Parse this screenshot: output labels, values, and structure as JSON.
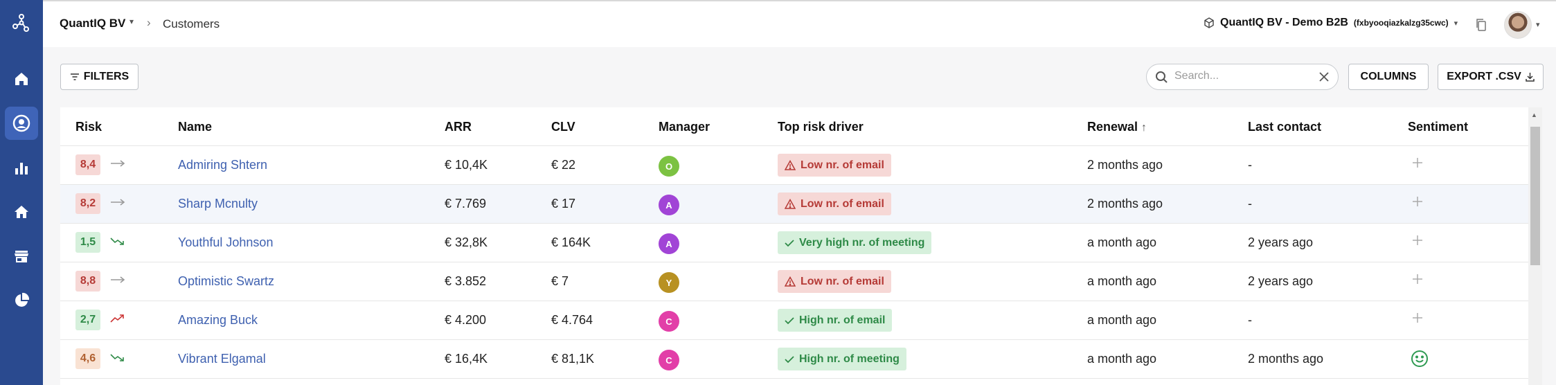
{
  "colors": {
    "sidebar": "#2a4a8f",
    "sidebar_active": "#3f64b8",
    "link": "#3f61b0",
    "risk_high_bg": "#f6d8d6",
    "risk_high_fg": "#b53a36",
    "risk_low_bg": "#d6f0dc",
    "risk_low_fg": "#2e8a47",
    "risk_mid_bg": "#f9e2d3",
    "risk_mid_fg": "#b0602f"
  },
  "sidebar": {
    "logo_icon": "network-logo-icon",
    "items": [
      {
        "icon": "home-icon"
      },
      {
        "icon": "user-circle-icon",
        "active": true
      },
      {
        "icon": "bar-chart-icon"
      },
      {
        "icon": "house-icon"
      },
      {
        "icon": "store-icon"
      },
      {
        "icon": "pie-chart-icon"
      }
    ]
  },
  "header": {
    "org": "QuantIQ BV",
    "separator": "›",
    "page": "Customers",
    "tenant_name": "QuantIQ BV - Demo B2B",
    "tenant_id": "(fxbyooqiazkalzg35cwc)"
  },
  "toolbar": {
    "filters_label": "FILTERS",
    "search_placeholder": "Search...",
    "columns_label": "COLUMNS",
    "export_label": "EXPORT .CSV"
  },
  "table": {
    "columns": [
      "Risk",
      "Name",
      "ARR",
      "CLV",
      "Manager",
      "Top risk driver",
      "Renewal",
      "Last contact",
      "Sentiment"
    ],
    "renewal_sort_arrow": "↑",
    "rows": [
      {
        "risk": "8,4",
        "level": "high",
        "trend": "flat",
        "name": "Admiring Shtern",
        "arr": "€ 10,4K",
        "clv": "€ 22",
        "manager": "O",
        "manager_color": "#7cc242",
        "driver": "Low nr. of email",
        "driver_kind": "warn",
        "renewal": "2 months ago",
        "last_contact": "-",
        "sentiment": "plus"
      },
      {
        "risk": "8,2",
        "level": "high",
        "trend": "flat",
        "name": "Sharp Mcnulty",
        "arr": "€ 7.769",
        "clv": "€ 17",
        "manager": "A",
        "manager_color": "#a144d6",
        "driver": "Low nr. of email",
        "driver_kind": "warn",
        "renewal": "2 months ago",
        "last_contact": "-",
        "sentiment": "plus",
        "highlight": true
      },
      {
        "risk": "1,5",
        "level": "low",
        "trend": "down",
        "name": "Youthful Johnson",
        "arr": "€ 32,8K",
        "clv": "€ 164K",
        "manager": "A",
        "manager_color": "#a144d6",
        "driver": "Very high nr. of meeting",
        "driver_kind": "ok",
        "renewal": "a month ago",
        "last_contact": "2 years ago",
        "sentiment": "plus"
      },
      {
        "risk": "8,8",
        "level": "high",
        "trend": "flat",
        "name": "Optimistic Swartz",
        "arr": "€ 3.852",
        "clv": "€ 7",
        "manager": "Y",
        "manager_color": "#b89122",
        "driver": "Low nr. of email",
        "driver_kind": "warn",
        "renewal": "a month ago",
        "last_contact": "2 years ago",
        "sentiment": "plus"
      },
      {
        "risk": "2,7",
        "level": "low",
        "trend": "up",
        "name": "Amazing Buck",
        "arr": "€ 4.200",
        "clv": "€ 4.764",
        "manager": "C",
        "manager_color": "#e23fa8",
        "driver": "High nr. of email",
        "driver_kind": "ok",
        "renewal": "a month ago",
        "last_contact": "-",
        "sentiment": "plus"
      },
      {
        "risk": "4,6",
        "level": "mid",
        "trend": "down",
        "name": "Vibrant Elgamal",
        "arr": "€ 16,4K",
        "clv": "€ 81,1K",
        "manager": "C",
        "manager_color": "#e23fa8",
        "driver": "High nr. of meeting",
        "driver_kind": "ok",
        "renewal": "a month ago",
        "last_contact": "2 months ago",
        "sentiment": "smile"
      }
    ]
  }
}
